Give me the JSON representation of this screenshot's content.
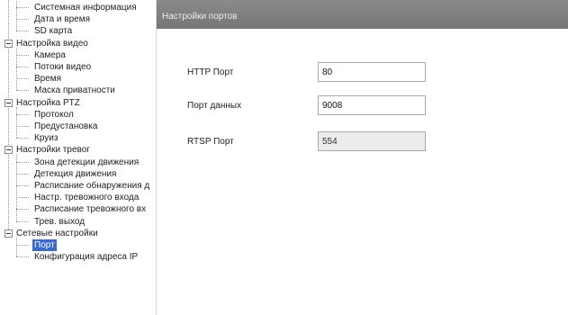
{
  "tree": {
    "items": [
      {
        "label": "Системная информация",
        "level": 1
      },
      {
        "label": "Дата и время",
        "level": 1
      },
      {
        "label": "SD карта",
        "level": 1
      },
      {
        "label": "Настройка видео",
        "level": 0
      },
      {
        "label": "Камера",
        "level": 1
      },
      {
        "label": "Потоки видео",
        "level": 1
      },
      {
        "label": "Время",
        "level": 1
      },
      {
        "label": "Маска приватности",
        "level": 1
      },
      {
        "label": "Настройка PTZ",
        "level": 0
      },
      {
        "label": "Протокол",
        "level": 1
      },
      {
        "label": "Предустановка",
        "level": 1
      },
      {
        "label": "Круиз",
        "level": 1
      },
      {
        "label": "Настройки тревог",
        "level": 0
      },
      {
        "label": "Зона детекции движения",
        "level": 1
      },
      {
        "label": "Детекция движения",
        "level": 1
      },
      {
        "label": "Расписание обнаружения д",
        "level": 1
      },
      {
        "label": "Настр. тревожного входа",
        "level": 1
      },
      {
        "label": "Расписание тревожного вх",
        "level": 1
      },
      {
        "label": "Трев. выход",
        "level": 1
      },
      {
        "label": "Сетевые настройки",
        "level": 0
      },
      {
        "label": "Порт",
        "level": 1,
        "selected": true
      },
      {
        "label": "Конфигурация адреса IP",
        "level": 1
      }
    ]
  },
  "main": {
    "header_title": "Настройки портов",
    "http_port_label": "HTTP Порт",
    "http_port_value": "80",
    "data_port_label": "Порт данных",
    "data_port_value": "9008",
    "rtsp_port_label": "RTSP Порт",
    "rtsp_port_value": "554"
  },
  "colors": {
    "header_bg": "#808080",
    "selection": "#3a6ad0"
  }
}
